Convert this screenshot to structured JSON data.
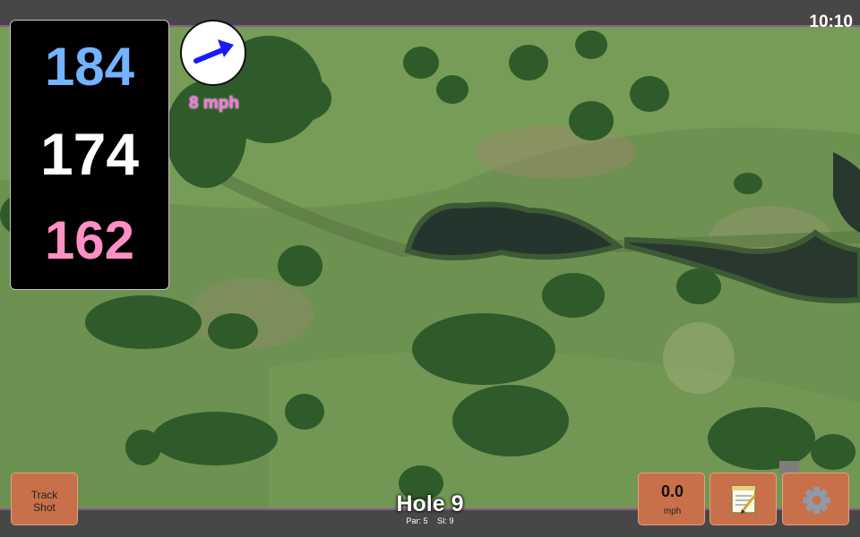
{
  "status_bar": {
    "time": "10:10"
  },
  "distances": {
    "back": "184",
    "middle": "174",
    "front": "162"
  },
  "wind": {
    "speed_label": "8 mph",
    "direction_icon": "arrow-right-up-icon"
  },
  "buttons": {
    "track_shot_line1": "Track",
    "track_shot_line2": "Shot",
    "speed_value": "0.0",
    "speed_unit": "mph",
    "notes_icon": "notepad-icon",
    "settings_icon": "gear-icon"
  },
  "hole": {
    "title": "Hole 9",
    "par": "Par: 5",
    "si": "SI: 9"
  },
  "colors": {
    "back": "#72b4ff",
    "middle": "#ffffff",
    "front": "#ff8fc4",
    "wind_arrow": "#1a1aff",
    "button": "#c8704a",
    "wind_text": "#ff6fe0"
  }
}
